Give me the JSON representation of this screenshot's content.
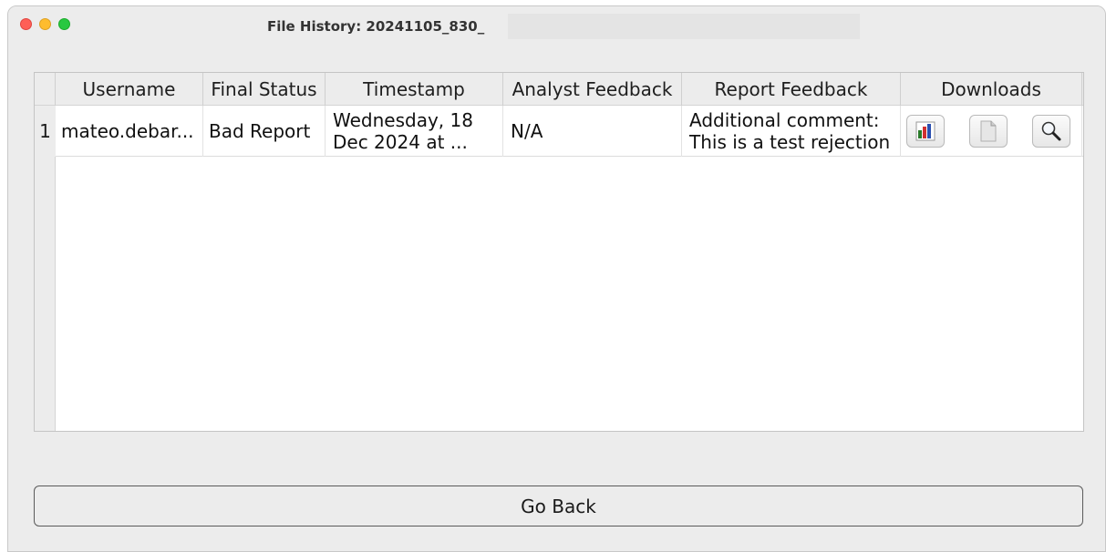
{
  "window": {
    "title": "File History: 20241105_830_"
  },
  "table": {
    "columns": [
      "Username",
      "Final Status",
      "Timestamp",
      "Analyst Feedback",
      "Report Feedback",
      "Downloads"
    ],
    "rows": [
      {
        "index": "1",
        "username": "mateo.debar...",
        "final_status": "Bad Report",
        "timestamp": "Wednesday, 18 Dec 2024 at ...",
        "analyst_feedback": "N/A",
        "report_feedback": "Additional comment: This is a test rejection",
        "downloads": [
          "bar-chart-icon",
          "document-icon",
          "magnifier-icon"
        ]
      }
    ]
  },
  "footer": {
    "go_back_label": "Go Back"
  }
}
